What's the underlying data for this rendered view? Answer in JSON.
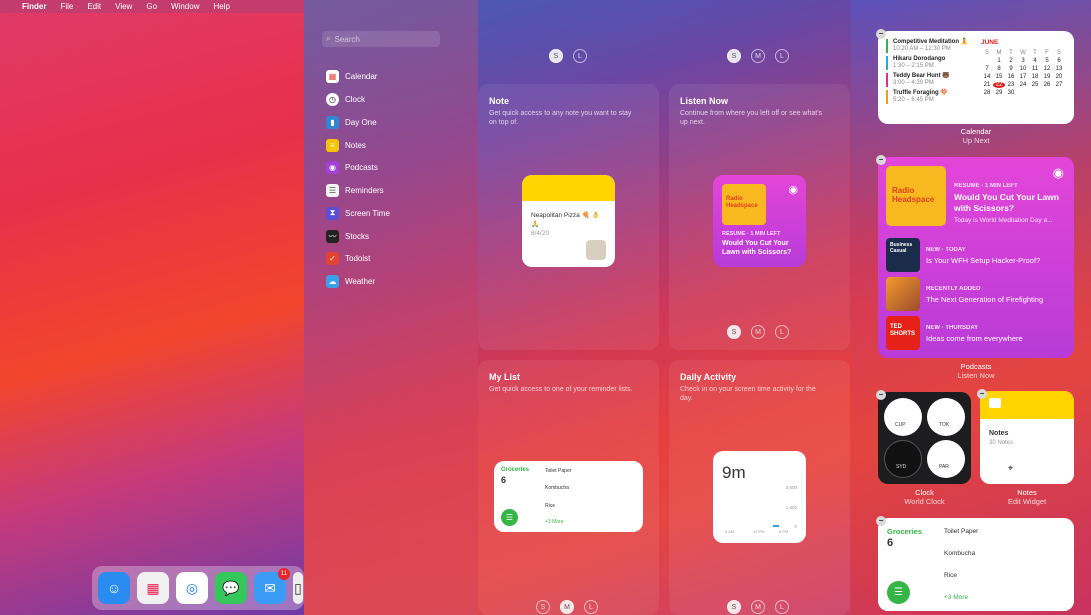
{
  "menubar": {
    "app": "Finder",
    "items": [
      "File",
      "Edit",
      "View",
      "Go",
      "Window",
      "Help"
    ]
  },
  "search": {
    "placeholder": "Search"
  },
  "sidebar": {
    "items": [
      {
        "label": "Calendar",
        "icon": "calendar-icon",
        "color": "#e9473f"
      },
      {
        "label": "Clock",
        "icon": "clock-icon",
        "color": "#222222"
      },
      {
        "label": "Day One",
        "icon": "day-one-icon",
        "color": "#2f86d6"
      },
      {
        "label": "Notes",
        "icon": "notes-icon",
        "color": "#f5c400"
      },
      {
        "label": "Podcasts",
        "icon": "podcasts-icon",
        "color": "#a63fd8"
      },
      {
        "label": "Reminders",
        "icon": "reminders-icon",
        "color": "#f4f4f4"
      },
      {
        "label": "Screen Time",
        "icon": "screen-time-icon",
        "color": "#5b4ed6"
      },
      {
        "label": "Stocks",
        "icon": "stocks-icon",
        "color": "#222222"
      },
      {
        "label": "Todoist",
        "icon": "todoist-icon",
        "color": "#e44332"
      },
      {
        "label": "Weather",
        "icon": "weather-icon",
        "color": "#3aa0e8"
      }
    ]
  },
  "sizes": {
    "s": "S",
    "m": "M",
    "l": "L"
  },
  "gallery": {
    "note": {
      "title": "Note",
      "desc": "Get quick access to any note you want to stay on top of.",
      "widget": {
        "text": "Neapolitan Pizza 🍕 👌 🙏",
        "date": "6/4/20"
      }
    },
    "listen": {
      "title": "Listen Now",
      "desc": "Continue from where you left off or see what's up next.",
      "widget": {
        "status": "RESUME · 1 MIN LEFT",
        "episode": "Would You Cut Your Lawn with Scissors?",
        "cover": "Radio Headspace"
      }
    },
    "mylist": {
      "title": "My List",
      "desc": "Get quick access to one of your reminder lists.",
      "widget": {
        "list": "Groceries",
        "count": "6",
        "items": [
          "Toilet Paper",
          "Kombucha",
          "Rice"
        ],
        "more": "+3 More"
      }
    },
    "daily": {
      "title": "Daily Activity",
      "desc": "Check in on your screen time activity for the day.",
      "widget": {
        "value": "9m",
        "ticks": [
          "3,600",
          "1,800",
          "0"
        ],
        "times": [
          "6 AM",
          "12 PM",
          "6 PM"
        ]
      }
    }
  },
  "right": {
    "calendar": {
      "events": [
        {
          "title": "Competitive Meditation 🧘",
          "time": "10:20 AM – 12:30 PM",
          "color": "#35b546"
        },
        {
          "title": "Hikaru Dorodango",
          "time": "1:30 – 2:15 PM",
          "color": "#2aa6e0"
        },
        {
          "title": "Teddy Bear Hunt 🐻",
          "time": "3:00 – 4:30 PM",
          "color": "#e0326e"
        },
        {
          "title": "Truffle Foraging 🍄",
          "time": "5:20 – 6:45 PM",
          "color": "#f29b16"
        }
      ],
      "month": "JUNE",
      "dow": [
        "S",
        "M",
        "T",
        "W",
        "T",
        "F",
        "S"
      ],
      "days": [
        "",
        "1",
        "2",
        "3",
        "4",
        "5",
        "6",
        "7",
        "8",
        "9",
        "10",
        "11",
        "12",
        "13",
        "14",
        "15",
        "16",
        "17",
        "18",
        "19",
        "20",
        "21",
        "22",
        "23",
        "24",
        "25",
        "26",
        "27",
        "28",
        "29",
        "30"
      ],
      "today": "22",
      "label": "Calendar",
      "sublabel": "Up Next"
    },
    "podcasts": {
      "top": {
        "status": "RESUME · 1 MIN LEFT",
        "title": "Would You Cut Your Lawn with Scissors?",
        "sub": "Today is World Meditation Day a...",
        "cover": "Radio Headspace"
      },
      "items": [
        {
          "status": "NEW · TODAY",
          "title": "Is Your WFH Setup Hacker-Proof?",
          "cover": "Business Casual"
        },
        {
          "status": "RECENTLY ADDED",
          "title": "The Next Generation of Firefighting",
          "cover": ""
        },
        {
          "status": "NEW · THURSDAY",
          "title": "Ideas come from everywhere",
          "cover": "TED SHORTS"
        }
      ],
      "label": "Podcasts",
      "sublabel": "Listen Now"
    },
    "clock": {
      "label": "Clock",
      "sublabel": "World Clock",
      "cities": [
        "CUP",
        "TOK",
        "SYD",
        "PAR"
      ]
    },
    "notes": {
      "title": "Notes",
      "sub": "30 Notes",
      "label": "Notes",
      "sublabel": "Edit Widget"
    },
    "reminders": {
      "list": "Groceries",
      "count": "6",
      "items": [
        "Toilet Paper",
        "Kombucha",
        "Rice"
      ],
      "more": "+3 More"
    }
  },
  "dock": {
    "apps": [
      {
        "name": "finder-icon",
        "color": "#2b8cf0",
        "glyph": "☺"
      },
      {
        "name": "launchpad-icon",
        "color": "#f0f0f0",
        "glyph": "▦"
      },
      {
        "name": "safari-icon",
        "color": "#ffffff",
        "glyph": "◎"
      },
      {
        "name": "messages-icon",
        "color": "#34c759",
        "glyph": "💬"
      },
      {
        "name": "mail-icon",
        "color": "#3b9cf5",
        "glyph": "✉",
        "badge": "11"
      },
      {
        "name": "app-icon",
        "color": "#eeeeee",
        "glyph": "▯"
      }
    ]
  }
}
